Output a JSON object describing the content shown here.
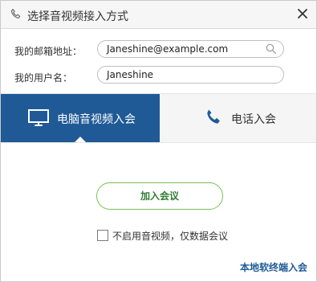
{
  "title_bar": {
    "title": "选择音视频接入方式",
    "phone_icon": "phone-icon",
    "close_icon": "close-icon"
  },
  "form": {
    "email_label": "我的邮箱地址：",
    "email_value": "Janeshine@example.com",
    "username_label": "我的用户名：",
    "username_value": "Janeshine"
  },
  "tabs": [
    {
      "label": "电脑音视频入会",
      "icon": "monitor-icon",
      "active": true
    },
    {
      "label": "电话入会",
      "icon": "phone-icon",
      "active": false
    }
  ],
  "join_button": "加入会议",
  "checkbox": {
    "label": "不启用音视频，仅数据会议",
    "checked": false
  },
  "local_link": "本地软终端入会",
  "colors": {
    "active_tab": "#1f5a96",
    "button_border": "#7cbf55",
    "button_text": "#2e7d32",
    "link": "#1f5a96"
  }
}
